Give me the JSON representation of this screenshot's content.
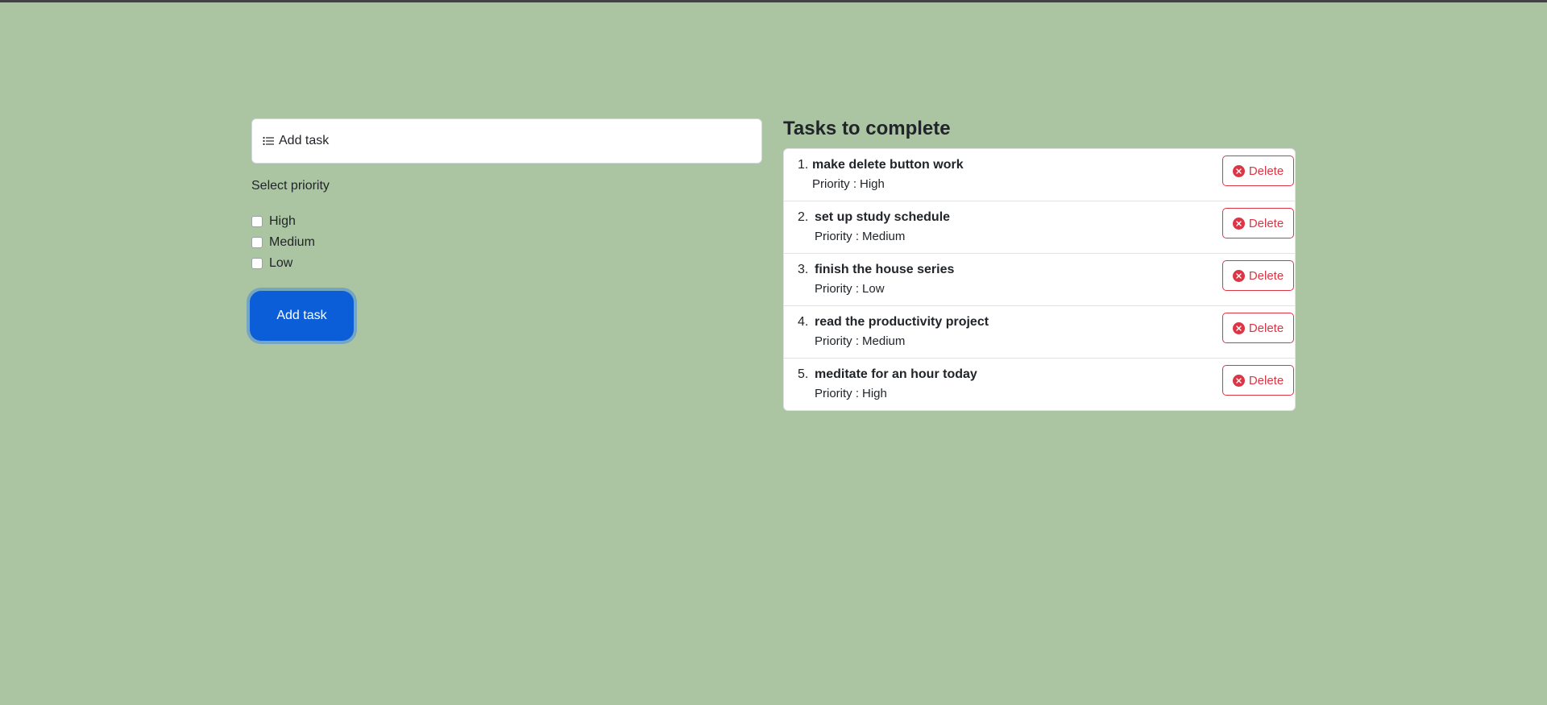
{
  "form": {
    "input_label": "Add task",
    "select_label": "Select priority",
    "priority_options": [
      "High",
      "Medium",
      "Low"
    ],
    "submit_label": "Add task"
  },
  "tasks_section": {
    "heading": "Tasks to complete",
    "priority_prefix": "Priority :",
    "delete_label": "Delete",
    "tasks": [
      {
        "num": "1.",
        "name": "make delete button work",
        "priority": "High"
      },
      {
        "num": "2.",
        "name": "set up study schedule",
        "priority": "Medium"
      },
      {
        "num": "3.",
        "name": "finish the house series",
        "priority": "Low"
      },
      {
        "num": "4.",
        "name": "read the productivity project",
        "priority": "Medium"
      },
      {
        "num": "5.",
        "name": "meditate for an hour today",
        "priority": "High"
      }
    ]
  },
  "colors": {
    "background": "#abc5a2",
    "primary": "#0b5ed7",
    "danger": "#dc3545"
  },
  "icons": {
    "input": "list-icon",
    "delete": "x-circle-icon"
  }
}
